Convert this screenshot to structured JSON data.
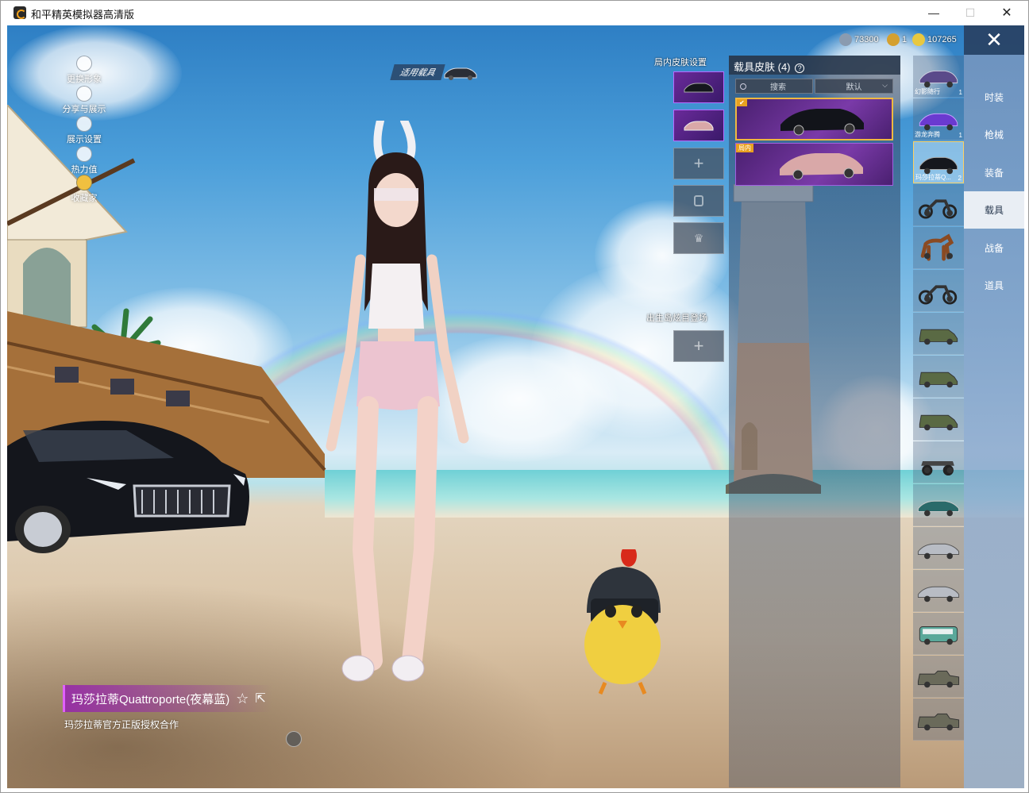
{
  "window": {
    "title": "和平精英模拟器高清版",
    "minimize_glyph": "—",
    "maximize_glyph": "☐",
    "close_glyph": "✕"
  },
  "left_menu": [
    {
      "label": "更换形象",
      "icon": "avatar-icon"
    },
    {
      "label": "分享与展示",
      "icon": "share-icon"
    },
    {
      "label": "展示设置",
      "icon": "eye-icon"
    },
    {
      "label": "热力值",
      "icon": "flame-icon"
    },
    {
      "label": "收藏家",
      "icon": "collector-icon"
    }
  ],
  "vehicle_tag": {
    "label": "适用载具"
  },
  "currency": [
    {
      "value": "73300",
      "color": "#8a9bb0",
      "icon": "silver-coin-icon"
    },
    {
      "value": "1",
      "color": "#d4a030",
      "icon": "token-icon"
    },
    {
      "value": "107265",
      "color": "#e8c840",
      "icon": "gold-coin-icon"
    }
  ],
  "close_glyph": "✕",
  "skin_settings": {
    "label": "局内皮肤设置",
    "add_glyph": "+",
    "spawn_label": "出生岛炫目登场"
  },
  "skin_panel": {
    "title": "载具皮肤 (4)",
    "help_glyph": "?",
    "search_placeholder": "搜索",
    "sort_value": "默认",
    "cards": [
      {
        "badge": "",
        "color": "#1a1c24",
        "selected": true
      },
      {
        "badge": "局内",
        "color": "#d9a8a8",
        "selected": false
      }
    ]
  },
  "vehicle_list": [
    {
      "name": "幻影随行",
      "count": "1",
      "kind": "car-purple"
    },
    {
      "name": "游龙奔腾",
      "count": "1",
      "kind": "car-neon"
    },
    {
      "name": "玛莎拉蒂Q...",
      "count": "2",
      "kind": "car-black",
      "selected": true
    },
    {
      "name": "",
      "count": "",
      "kind": "motorbike"
    },
    {
      "name": "",
      "count": "",
      "kind": "horse"
    },
    {
      "name": "",
      "count": "",
      "kind": "motorbike"
    },
    {
      "name": "",
      "count": "",
      "kind": "jeep"
    },
    {
      "name": "",
      "count": "",
      "kind": "jeep"
    },
    {
      "name": "",
      "count": "",
      "kind": "jeep"
    },
    {
      "name": "",
      "count": "",
      "kind": "monster-truck"
    },
    {
      "name": "",
      "count": "",
      "kind": "sedan-teal"
    },
    {
      "name": "",
      "count": "",
      "kind": "sedan-silver"
    },
    {
      "name": "",
      "count": "",
      "kind": "sedan-silver"
    },
    {
      "name": "",
      "count": "",
      "kind": "van"
    },
    {
      "name": "",
      "count": "",
      "kind": "pickup"
    },
    {
      "name": "",
      "count": "",
      "kind": "pickup"
    }
  ],
  "categories": [
    {
      "label": "时装",
      "active": false
    },
    {
      "label": "枪械",
      "active": false
    },
    {
      "label": "装备",
      "active": false
    },
    {
      "label": "载具",
      "active": true
    },
    {
      "label": "战备",
      "active": false
    },
    {
      "label": "道具",
      "active": false
    }
  ],
  "selected_skin": {
    "name": "玛莎拉蒂Quattroporte(夜幕蓝)",
    "license": "玛莎拉蒂官方正版授权合作"
  }
}
